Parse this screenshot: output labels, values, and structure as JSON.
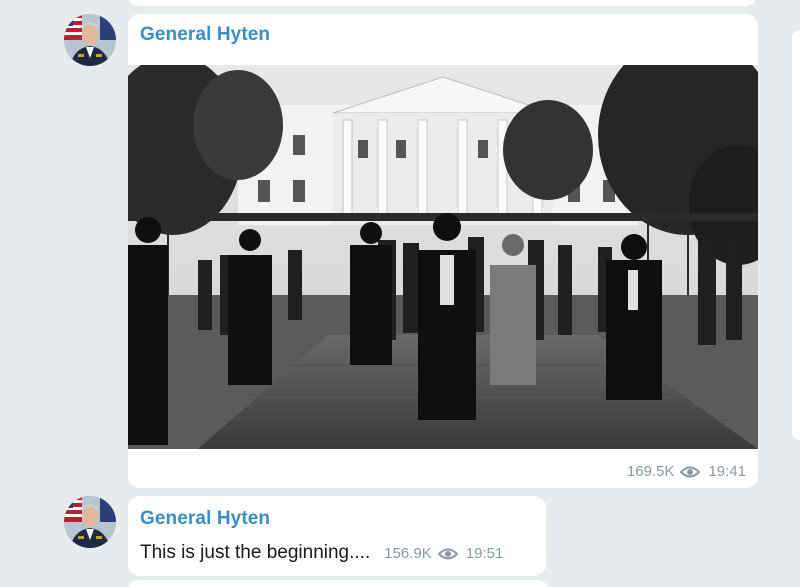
{
  "channel_feed": {
    "messages": [
      {
        "sender": "General Hyten",
        "views": "169.5K",
        "time": "19:41",
        "avatar_icon": "profile-photo-icon",
        "media": "photo"
      },
      {
        "sender": "General Hyten",
        "text": "This is just the beginning....",
        "views": "156.9K",
        "time": "19:51",
        "avatar_icon": "profile-photo-icon"
      }
    ]
  },
  "colors": {
    "background": "#e6ebee",
    "bubble": "#ffffff",
    "sender_name": "#3a8fc7",
    "meta_text": "#8a97a3"
  }
}
